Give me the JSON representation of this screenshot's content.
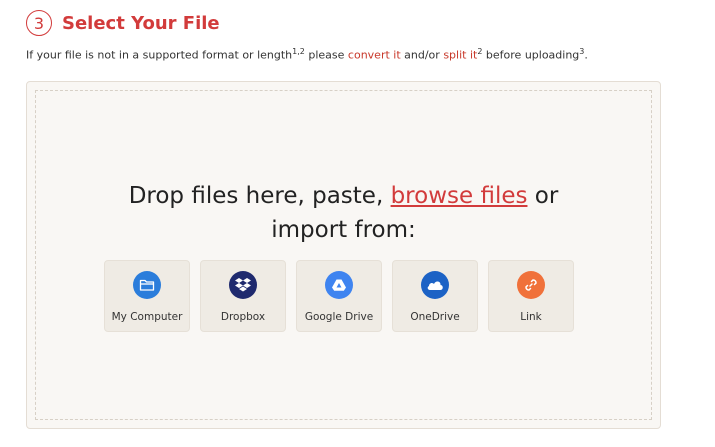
{
  "header": {
    "step_number": "3",
    "title": "Select Your File"
  },
  "subtitle": {
    "part1": "If your file is not in a supported format or length",
    "sup1": "1,2",
    "part2": " please ",
    "convert_link": "convert it",
    "part3": " and/or ",
    "split_link": "split it",
    "sup2": "2",
    "part4": " before uploading",
    "sup3": "3",
    "part5": "."
  },
  "dropzone": {
    "line1_prefix": "Drop files here, paste, ",
    "browse_link": "browse files",
    "line1_suffix": " or",
    "line2": "import from:"
  },
  "sources": [
    {
      "label": "My Computer",
      "icon": "folder-icon",
      "color": "#2b7ddb"
    },
    {
      "label": "Dropbox",
      "icon": "dropbox-icon",
      "color": "#1f2a6e"
    },
    {
      "label": "Google Drive",
      "icon": "google-drive-icon",
      "color": "#3f84f0"
    },
    {
      "label": "OneDrive",
      "icon": "onedrive-icon",
      "color": "#1c62c5"
    },
    {
      "label": "Link",
      "icon": "link-icon",
      "color": "#f0713a"
    }
  ]
}
